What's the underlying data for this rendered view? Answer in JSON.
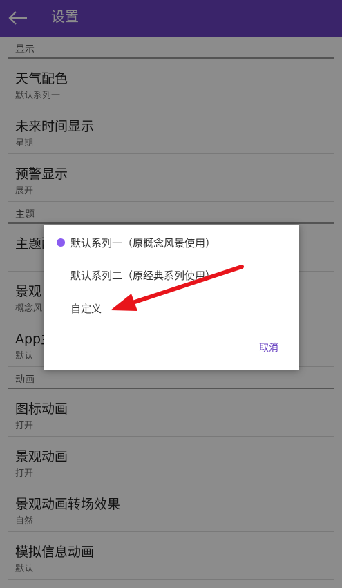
{
  "appbar": {
    "title": "设置",
    "back_icon": "arrow-left-icon"
  },
  "sections": [
    {
      "header": "显示",
      "items": [
        {
          "title": "天气配色",
          "value": "默认系列一"
        },
        {
          "title": "未来时间显示",
          "value": "星期"
        },
        {
          "title": "预警显示",
          "value": "展开"
        }
      ]
    },
    {
      "header": "主题",
      "items": [
        {
          "title": "主题配",
          "value": ""
        },
        {
          "title": "景观",
          "value": "概念风"
        },
        {
          "title": "App主",
          "value": "默认"
        }
      ]
    },
    {
      "header": "动画",
      "items": [
        {
          "title": "图标动画",
          "value": "打开"
        },
        {
          "title": "景观动画",
          "value": "打开"
        },
        {
          "title": "景观动画转场效果",
          "value": "自然"
        },
        {
          "title": "模拟信息动画",
          "value": "默认"
        }
      ]
    }
  ],
  "dialog": {
    "options": [
      {
        "label": "默认系列一（原概念风景使用）",
        "selected": true
      },
      {
        "label": "默认系列二（原经典系列使用）",
        "selected": false
      },
      {
        "label": "自定义",
        "selected": false
      }
    ],
    "cancel_label": "取消"
  },
  "colors": {
    "appbar": "#6a43c2",
    "radio_selected": "#8a5cf0",
    "annotation_arrow": "#e8141b"
  }
}
